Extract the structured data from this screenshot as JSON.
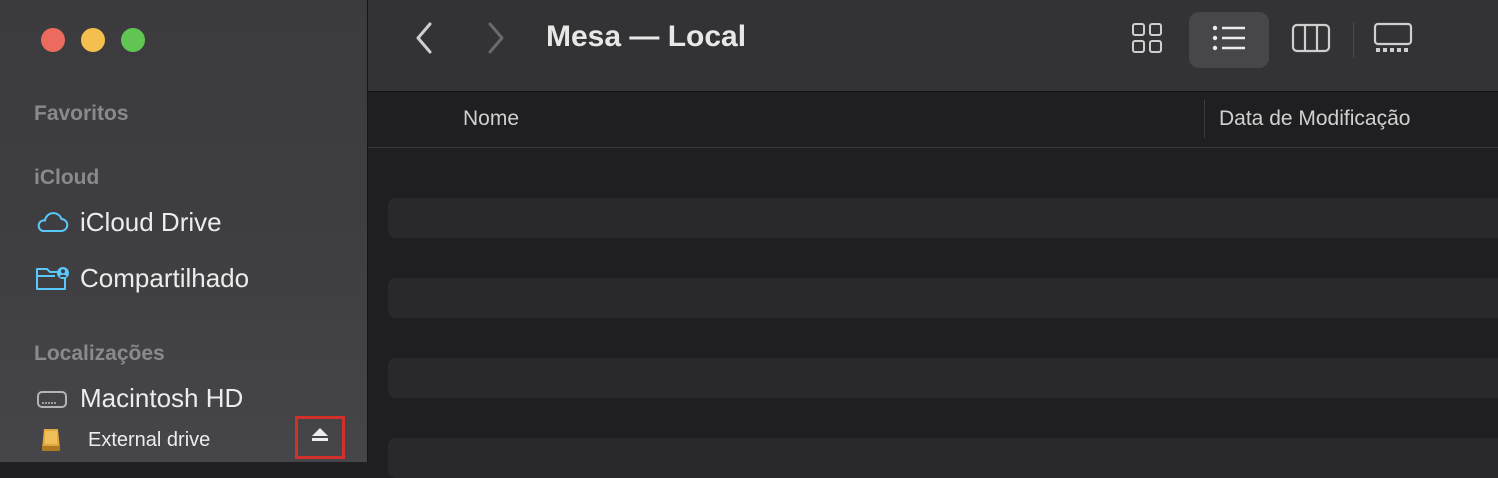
{
  "window": {
    "title": "Mesa — Local"
  },
  "traffic_lights": {
    "close_color": "#ed6a5e",
    "minimize_color": "#f5bf4f",
    "zoom_color": "#61c554"
  },
  "sidebar": {
    "sections": [
      {
        "title": "Favoritos",
        "items": []
      },
      {
        "title": "iCloud",
        "items": [
          {
            "label": "iCloud Drive",
            "icon": "cloud-icon"
          },
          {
            "label": "Compartilhado",
            "icon": "shared-folder-icon"
          }
        ]
      },
      {
        "title": "Localizações",
        "items": [
          {
            "label": "Macintosh HD",
            "icon": "hard-drive-icon"
          },
          {
            "label": "External drive",
            "icon": "external-drive-icon",
            "eject": "eject-icon"
          }
        ]
      }
    ]
  },
  "toolbar": {
    "back_icon": "chevron-left-icon",
    "forward_icon": "chevron-right-icon",
    "views": [
      {
        "name": "icon-view",
        "icon": "grid-icon",
        "active": false
      },
      {
        "name": "list-view",
        "icon": "list-icon",
        "active": true
      },
      {
        "name": "column-view",
        "icon": "columns-icon",
        "active": false
      },
      {
        "name": "gallery-view",
        "icon": "gallery-icon",
        "active": false
      }
    ]
  },
  "file_list": {
    "columns": [
      "Nome",
      "Data de Modificação"
    ],
    "rows": []
  },
  "colors": {
    "accent": "#5ac8fa",
    "highlight_border": "#d3302c"
  }
}
